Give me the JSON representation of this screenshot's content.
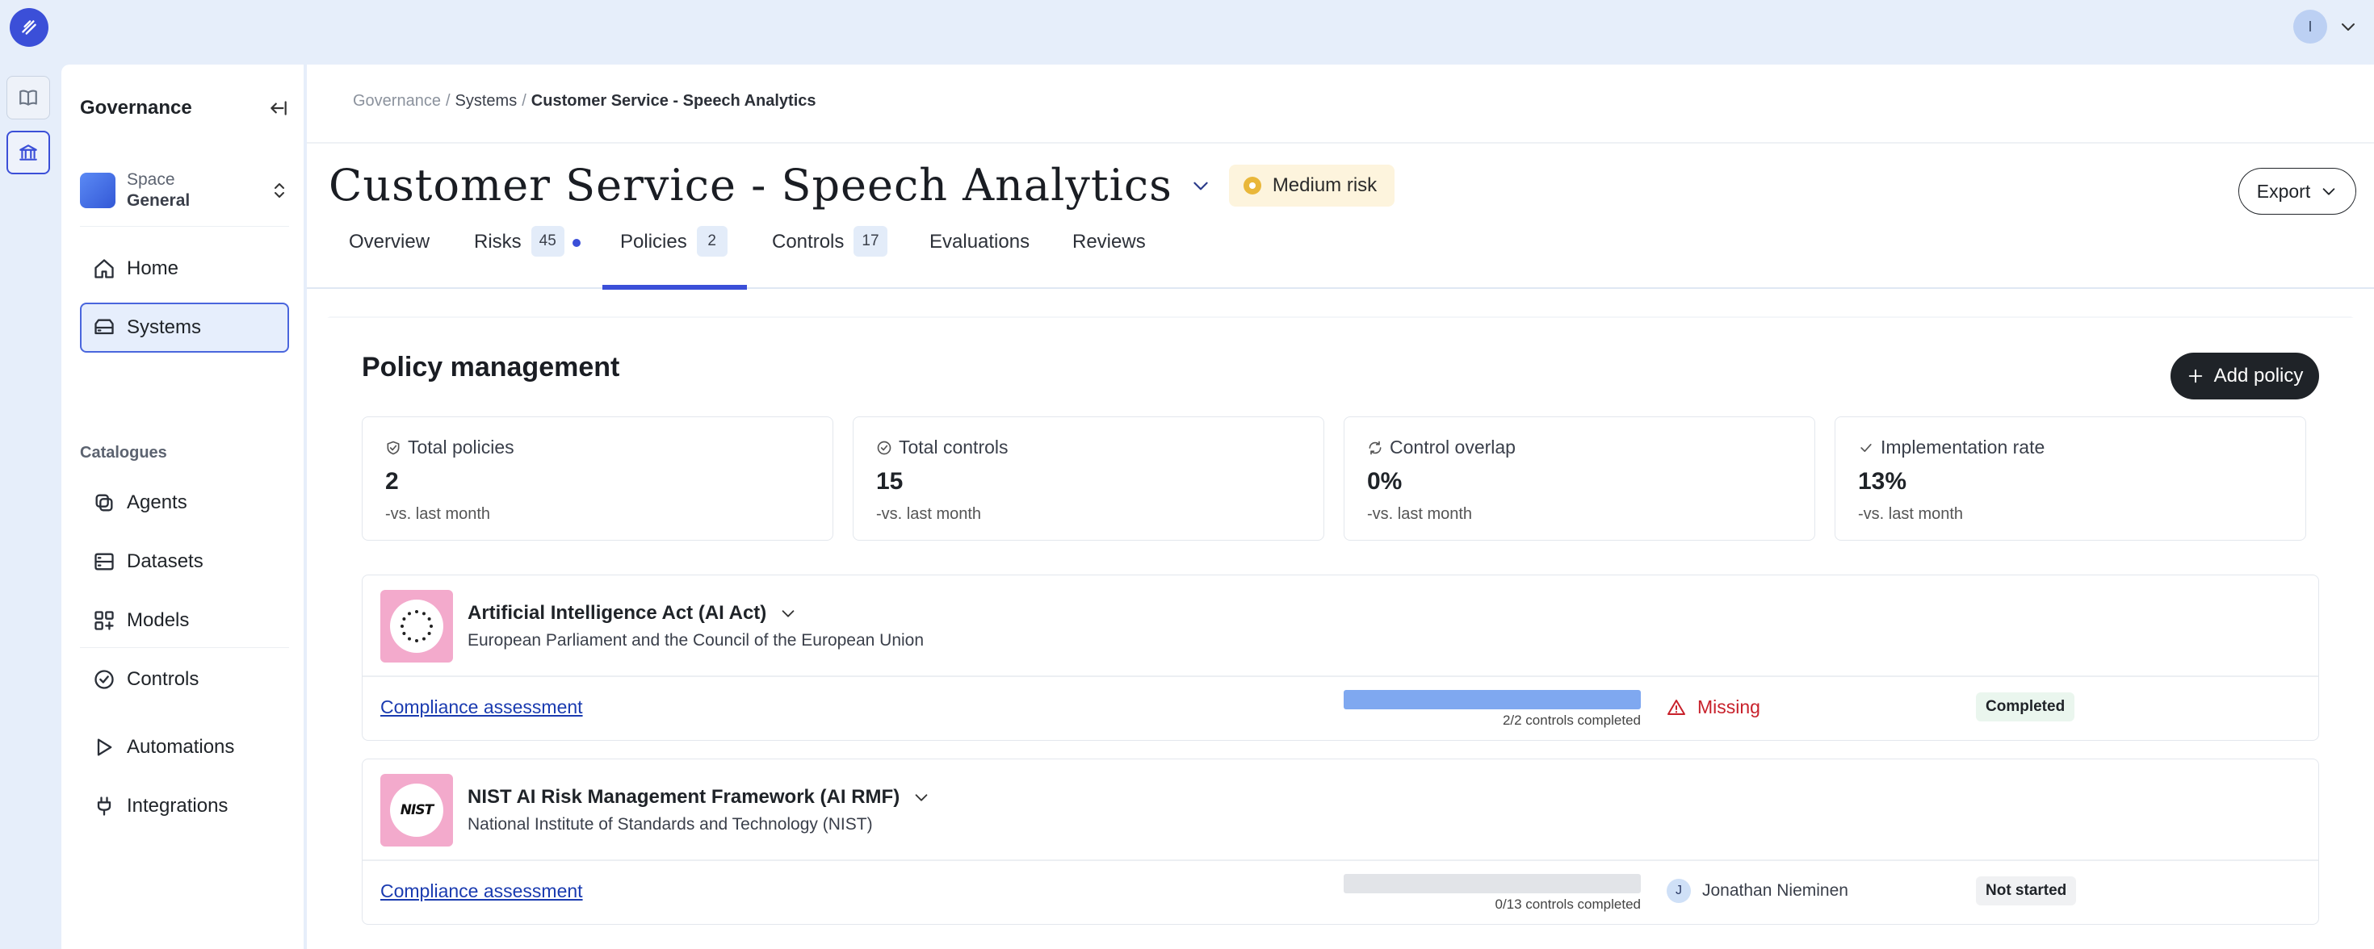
{
  "topbar": {
    "user_initial": "I"
  },
  "sidebar": {
    "title": "Governance",
    "space": {
      "label": "Space",
      "name": "General"
    },
    "nav": [
      {
        "label": "Home",
        "icon": "home-icon"
      },
      {
        "label": "Systems",
        "icon": "systems-icon",
        "active": true
      }
    ],
    "catalogues_label": "Catalogues",
    "catalogues": [
      {
        "label": "Agents",
        "icon": "agents-icon"
      },
      {
        "label": "Datasets",
        "icon": "datasets-icon"
      },
      {
        "label": "Models",
        "icon": "models-icon"
      },
      {
        "label": "Controls",
        "icon": "controls-icon"
      }
    ],
    "tools": [
      {
        "label": "Automations",
        "icon": "play-icon"
      },
      {
        "label": "Integrations",
        "icon": "plug-icon"
      }
    ]
  },
  "breadcrumb": {
    "root": "Governance",
    "parent": "Systems",
    "current": "Customer Service - Speech Analytics",
    "separator": "/"
  },
  "header": {
    "title": "Customer Service - Speech Analytics",
    "risk_badge": "Medium risk",
    "export_label": "Export"
  },
  "tabs": [
    {
      "label": "Overview"
    },
    {
      "label": "Risks",
      "count": "45",
      "dot": true
    },
    {
      "label": "Policies",
      "count": "2",
      "active": true
    },
    {
      "label": "Controls",
      "count": "17"
    },
    {
      "label": "Evaluations"
    },
    {
      "label": "Reviews"
    }
  ],
  "policy_management": {
    "title": "Policy management",
    "add_label": "Add policy",
    "stats": [
      {
        "label": "Total policies",
        "value": "2",
        "trend_sign": "-",
        "trend": "vs. last month",
        "icon": "shield-icon"
      },
      {
        "label": "Total controls",
        "value": "15",
        "trend_sign": "-",
        "trend": "vs. last month",
        "icon": "check-circle-icon"
      },
      {
        "label": "Control overlap",
        "value": "0%",
        "trend_sign": "-",
        "trend": "vs. last month",
        "icon": "refresh-icon"
      },
      {
        "label": "Implementation rate",
        "value": "13%",
        "trend_sign": "-",
        "trend": "vs. last month",
        "icon": "check-icon"
      }
    ],
    "policies": [
      {
        "name": "Artificial Intelligence Act (AI Act)",
        "publisher": "European Parliament and the Council of the European Union",
        "assessment_label": "Compliance assessment",
        "progress": 1.0,
        "progress_text": "2/2 controls completed",
        "status": "Missing",
        "state": "Completed"
      },
      {
        "name": "NIST AI Risk Management Framework (AI RMF)",
        "publisher": "National Institute of Standards and Technology (NIST)",
        "logo_text": "NIST",
        "assessment_label": "Compliance assessment",
        "progress": 0.0,
        "progress_text": "0/13 controls completed",
        "assignee_initial": "J",
        "assignee": "Jonathan Nieminen",
        "state": "Not started"
      }
    ]
  },
  "colors": {
    "accent": "#3b4fd8",
    "background": "#e6eefa",
    "risk_medium": "#e9b73a",
    "danger": "#c8212b",
    "progress_fill": "#7fa8f0",
    "policy_logo_bg": "#f3aacc"
  }
}
